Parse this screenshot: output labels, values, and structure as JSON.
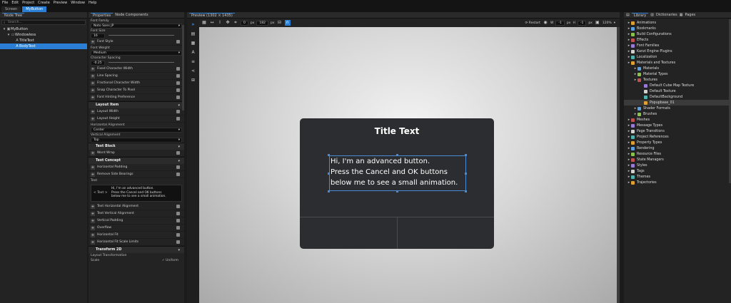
{
  "menubar": [
    "File",
    "Edit",
    "Project",
    "Create",
    "Preview",
    "Window",
    "Help"
  ],
  "doc_tabs": [
    "Screen",
    "MyButton"
  ],
  "node_tree": {
    "title": "Node Tree",
    "search_placeholder": "Search...",
    "items": [
      {
        "label": "MyButton",
        "depth": 0
      },
      {
        "label": "Windowless",
        "depth": 1
      },
      {
        "label": "TitleText",
        "depth": 2
      },
      {
        "label": "BodyText",
        "depth": 2
      }
    ]
  },
  "properties": {
    "tabs": [
      "Properties",
      "Node Components"
    ],
    "font_family_label": "Font Family",
    "font_family_value": "Noto Sans JP",
    "font_size_label": "Font Size",
    "font_size_value": "16",
    "font_style_label": "Font Style",
    "font_weight_label": "Font Weight",
    "font_weight_value": "Medium",
    "char_spacing_label": "Character Spacing",
    "char_spacing_value": "-0.25",
    "rows_a": [
      "Fixed Character Width",
      "Line Spacing",
      "Fractional Character Width",
      "Snap Character To Pixel",
      "Font Hinting Preference"
    ],
    "layout_item": "Layout Item",
    "rows_b": [
      "Layout Width",
      "Layout Height"
    ],
    "h_align_label": "Horizontal Alignment",
    "h_align_value": "Center",
    "v_align_label": "Vertical Alignment",
    "v_align_value": "Top",
    "text_block": "Text Block",
    "word_wrap": "Word Wrap",
    "text_concept": "Text Concept",
    "rows_c": [
      "Horizontal Padding",
      "Remove Side Bearings"
    ],
    "text_label": "Text",
    "text_tag": "< Text >",
    "text_value": "Hi, I'm an advanced button.\nPress the Cancel and OK buttons\nbelow me to see a small animation.",
    "rows_d": [
      "Text Horizontal Alignment",
      "Text Vertical Alignment",
      "Vertical Padding",
      "Overflow",
      "Horizontal Fit",
      "Horizontal Fit Scale Limits"
    ],
    "transform": "Transform 2D",
    "layout_transformation": "Layout Transformation",
    "scale_label": "Scale",
    "uniform_label": "Uniform"
  },
  "preview": {
    "tab": "Preview (1302 × 1435)",
    "x_value": "0",
    "x_unit": "px",
    "y_value": "182",
    "y_unit": "px",
    "restart": "Restart",
    "w_label": "W",
    "w_value": "-1",
    "w_unit": "px",
    "h_label": "H",
    "h_value": "-1",
    "h_unit": "px",
    "zoom": "120%"
  },
  "dialog": {
    "title": "Title Text",
    "body": "Hi, I'm an advanced button.\nPress the Cancel and OK buttons\nbelow me to see a small animation."
  },
  "library": {
    "tabs": [
      "Library",
      "Dictionaries",
      "Pages"
    ],
    "items": [
      {
        "label": "Animations",
        "depth": 0
      },
      {
        "label": "Bookmarks",
        "depth": 0
      },
      {
        "label": "Build Configurations",
        "depth": 0
      },
      {
        "label": "Effects",
        "depth": 0
      },
      {
        "label": "Font Families",
        "depth": 0
      },
      {
        "label": "Kanzi Engine Plugins",
        "depth": 0
      },
      {
        "label": "Localization",
        "depth": 0
      },
      {
        "label": "Materials and Textures",
        "depth": 0
      },
      {
        "label": "Materials",
        "depth": 1
      },
      {
        "label": "Material Types",
        "depth": 1
      },
      {
        "label": "Textures",
        "depth": 1
      },
      {
        "label": "Default Cube Map Texture",
        "depth": 2
      },
      {
        "label": "Default Texture",
        "depth": 2
      },
      {
        "label": "DefaultBackground",
        "depth": 2
      },
      {
        "label": "Popupbase_01",
        "depth": 2,
        "selected": true
      },
      {
        "label": "Shader Formats",
        "depth": 1
      },
      {
        "label": "Brushes",
        "depth": 1
      },
      {
        "label": "Meshes",
        "depth": 0
      },
      {
        "label": "Message Types",
        "depth": 0
      },
      {
        "label": "Page Transitions",
        "depth": 0
      },
      {
        "label": "Project References",
        "depth": 0
      },
      {
        "label": "Property Types",
        "depth": 0
      },
      {
        "label": "Rendering",
        "depth": 0
      },
      {
        "label": "Resource Files",
        "depth": 0
      },
      {
        "label": "State Managers",
        "depth": 0
      },
      {
        "label": "Styles",
        "depth": 0
      },
      {
        "label": "Tags",
        "depth": 0
      },
      {
        "label": "Themes",
        "depth": 0
      },
      {
        "label": "Trajectories",
        "depth": 0
      }
    ]
  },
  "colors": {
    "accent": "#2a7fd4",
    "dialog_bg": "#2c2d30"
  }
}
